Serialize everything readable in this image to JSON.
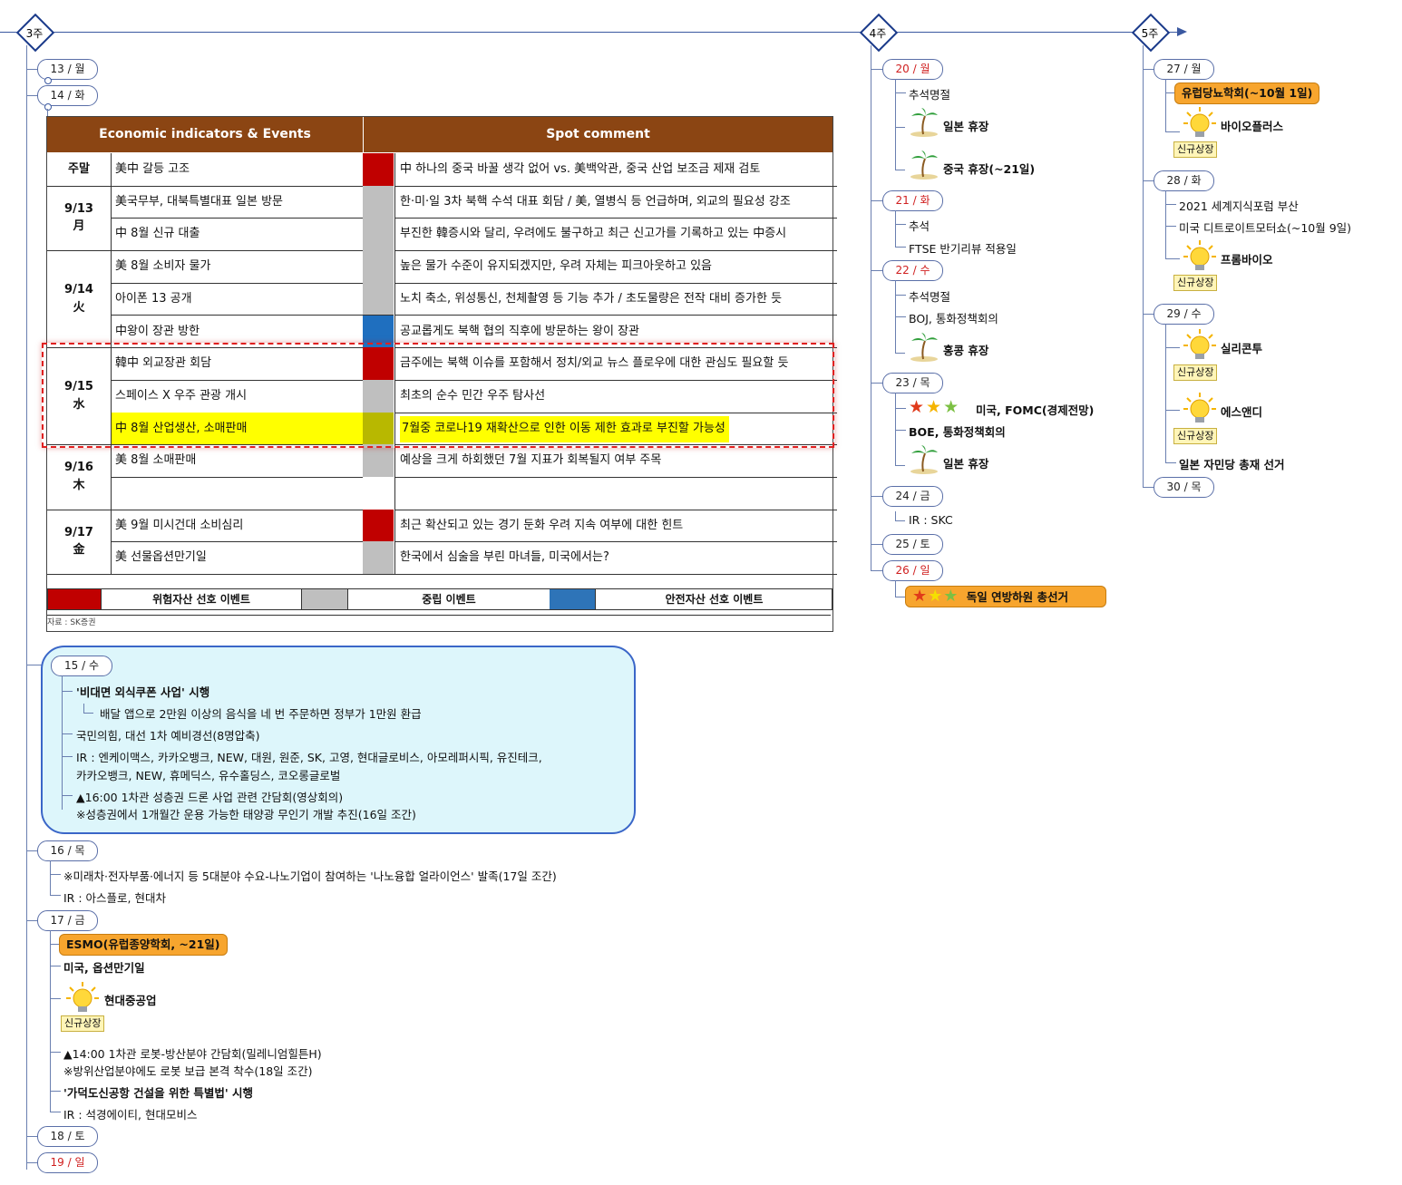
{
  "weeks": [
    "3주",
    "4주",
    "5주"
  ],
  "week3": {
    "days": [
      {
        "label": "13 / 월"
      },
      {
        "label": "14 / 화"
      },
      {
        "label": "15 / 수"
      },
      {
        "label": "16 / 목"
      },
      {
        "label": "17 / 금"
      },
      {
        "label": "18 / 토"
      },
      {
        "label": "19 / 일"
      }
    ],
    "table": {
      "headers": [
        "Economic indicators & Events",
        "Spot comment"
      ],
      "rows": [
        {
          "date": "주말",
          "event": "美中 갈등 고조",
          "sig": "red",
          "comment": "中 하나의 중국 바꿀 생각 없어 vs. 美백악관, 중국 산업 보조금 제재 검토"
        },
        {
          "date": "9/13\n月",
          "event": "美국무부, 대북특별대표 일본 방문",
          "sig": "gray",
          "comment": "한·미·일 3차 북핵 수석 대표 회담 / 美, 열병식 등 언급하며, 외교의 필요성 강조"
        },
        {
          "date": "",
          "event": "中 8월 신규 대출",
          "sig": "gray",
          "comment": "부진한 韓증시와 달리, 우려에도 불구하고 최근 신고가를 기록하고 있는 中증시"
        },
        {
          "date": "9/14\n火",
          "event": "美 8월 소비자 물가",
          "sig": "gray",
          "comment": "높은 물가 수준이 유지되겠지만, 우려 자체는 피크아웃하고 있음"
        },
        {
          "date": "",
          "event": "아이폰 13 공개",
          "sig": "gray",
          "comment": "노치 축소, 위성통신, 천체촬영 등 기능 추가 / 초도물량은 전작 대비 증가한 듯"
        },
        {
          "date": "",
          "event": "中왕이 장관 방한",
          "sig": "blue",
          "comment": "공교롭게도 북핵 협의 직후에 방문하는 왕이 장관"
        },
        {
          "date": "9/15\n水",
          "event": "韓中 외교장관 회담",
          "sig": "red",
          "comment": "금주에는 북핵 이슈를 포함해서 정치/외교 뉴스 플로우에 대한 관심도 필요할 듯"
        },
        {
          "date": "",
          "event": "스페이스 X 우주 관광 개시",
          "sig": "gray",
          "comment": "최초의 순수 민간 우주 탐사선"
        },
        {
          "date": "",
          "event": "中 8월 산업생산, 소매판매",
          "sig": "olive",
          "comment": "7월중 코로나19 재확산으로 인한 이동 제한 효과로 부진할 가능성",
          "highlight": true
        },
        {
          "date": "9/16\n木",
          "event": "美 8월 소매판매",
          "sig": "gray",
          "comment": "예상을 크게 하회했던 7월 지표가 회복될지 여부 주목"
        },
        {
          "date": "",
          "event": "",
          "sig": "none",
          "comment": ""
        },
        {
          "date": "9/17\n金",
          "event": "美 9월 미시건대 소비심리",
          "sig": "red",
          "comment": "최근 확산되고 있는 경기 둔화 우려 지속 여부에 대한 힌트"
        },
        {
          "date": "",
          "event": "美 선물옵션만기일",
          "sig": "gray",
          "comment": "한국에서 심술을 부린 마녀들, 미국에서는?"
        }
      ],
      "legend": [
        "위험자산 선호 이벤트",
        "중립 이벤트",
        "안전자산 선호 이벤트"
      ],
      "source": "자료 : SK증권"
    },
    "d15": {
      "items": [
        "'비대면 외식쿠폰 사업' 시행",
        "배달 앱으로 2만원 이상의 음식을 네 번 주문하면 정부가 1만원 환급",
        "국민의힘, 대선 1차 예비경선(8명압축)",
        "IR : 엔케이맥스, 카카오뱅크, NEW, 대원, 원준, SK, 고영, 현대글로비스, 아모레퍼시픽, 유진테크,",
        "카카오뱅크, NEW, 휴메딕스, 유수홀딩스, 코오롱글로벌",
        "▲16:00 1차관 성층권 드론 사업 관련 간담회(영상회의)",
        "※성층권에서 1개월간 운용 가능한 태양광 무인기 개발 추진(16일 조간)"
      ]
    },
    "d16": {
      "items": [
        "※미래차·전자부품·에너지 등 5대분야 수요-나노기업이 참여하는 '나노융합 얼라이언스' 발족(17일 조간)",
        "IR : 아스플로, 현대차"
      ]
    },
    "d17": {
      "esmo": "ESMO(유럽종양학회, ~21일)",
      "items": [
        "미국, 옵션만기일",
        "현대중공업",
        "▲14:00 1차관 로봇-방산분야 간담회(밀레니엄힐튼H)",
        "※방위산업분야에도 로봇 보급 본격 착수(18일 조간)",
        "'가덕도신공항 건설을 위한 특별법' 시행",
        "IR : 석경에이티, 현대모비스"
      ],
      "tag": "신규상장"
    }
  },
  "week4": {
    "days": [
      {
        "label": "20 / 월",
        "items": [
          "추석명절",
          "일본 휴장",
          "중국 휴장(~21일)"
        ]
      },
      {
        "label": "21 / 화",
        "items": [
          "추석",
          "FTSE 반기리뷰 적용일"
        ]
      },
      {
        "label": "22 / 수",
        "items": [
          "추석명절",
          "BOJ, 통화정책회의",
          "홍콩 휴장"
        ]
      },
      {
        "label": "23 / 목",
        "items": [
          "미국, FOMC(경제전망)",
          "BOE, 통화정책회의",
          "일본 휴장"
        ]
      },
      {
        "label": "24 / 금",
        "items": [
          "IR : SKC"
        ]
      },
      {
        "label": "25 / 토",
        "items": []
      },
      {
        "label": "26 / 일",
        "items": [
          "독일 연방하원 총선거"
        ]
      }
    ]
  },
  "week5": {
    "days": [
      {
        "label": "27 / 월",
        "items": [
          "유럽당뇨학회(~10월 1일)",
          "바이오플러스"
        ]
      },
      {
        "label": "28 / 화",
        "items": [
          "2021 세계지식포럼 부산",
          "미국 디트로이트모터쇼(~10월 9일)",
          "프롬바이오"
        ]
      },
      {
        "label": "29 / 수",
        "items": [
          "실리콘투",
          "에스앤디",
          "일본 자민당 총재 선거"
        ]
      },
      {
        "label": "30 / 목",
        "items": []
      }
    ],
    "tag": "신규상장"
  },
  "colors": {
    "red": "#c00000",
    "gray": "#bfbfbf",
    "blue": "#1f6fbf",
    "olive": "#b8b800",
    "brown": "#8b4513",
    "orange": "#f7a52e",
    "highlight": "#ffff00"
  }
}
